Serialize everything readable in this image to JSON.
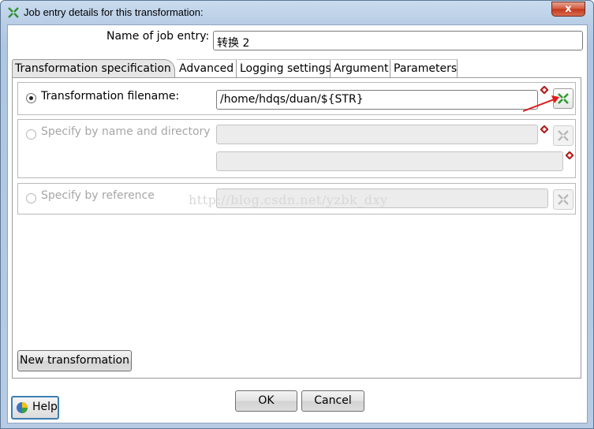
{
  "window": {
    "title": "Job entry details for this transformation:",
    "close_label": "x"
  },
  "name_of_job_entry": {
    "label": "Name of job entry:",
    "value": "转换 2"
  },
  "tabs": [
    {
      "label": "Transformation specification",
      "active": true
    },
    {
      "label": "Advanced",
      "active": false
    },
    {
      "label": "Logging settings",
      "active": false
    },
    {
      "label": "Argument",
      "active": false
    },
    {
      "label": "Parameters",
      "active": false
    }
  ],
  "specification": {
    "filename_option": {
      "label": "Transformation filename:",
      "selected": true,
      "value": "/home/hdqs/duan/${STR}"
    },
    "name_directory_option": {
      "label": "Specify by name and directory",
      "selected": false,
      "name_value": "",
      "directory_value": ""
    },
    "reference_option": {
      "label": "Specify by reference",
      "selected": false,
      "value": ""
    }
  },
  "watermark": "http://blog.csdn.net/yzbk_dxy",
  "buttons": {
    "new_transformation": "New transformation",
    "ok": "OK",
    "cancel": "Cancel",
    "help": "Help"
  },
  "icons": {
    "app": "spoon-transformation-icon",
    "variable": "variable-diamond-icon",
    "browse": "browse-file-icon",
    "help": "help-icon"
  },
  "colors": {
    "browse_active": "#2e9a2e",
    "variable_diamond": "#d62828",
    "annotation_arrow": "#e11a1a"
  }
}
